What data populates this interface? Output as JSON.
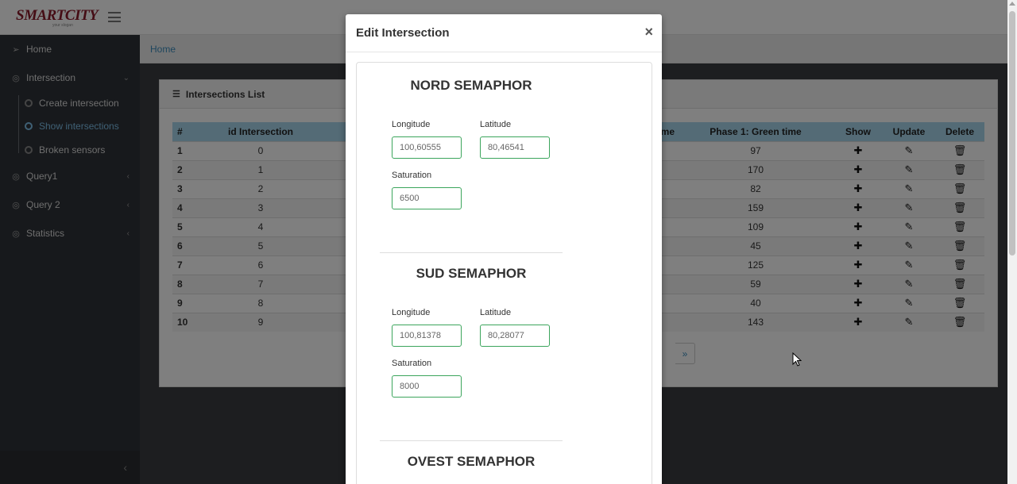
{
  "app": {
    "logo_main": "SMARTCITY",
    "logo_sub": "your slogan"
  },
  "sidebar": {
    "items": [
      {
        "label": "Home",
        "icon": "paper-plane-icon"
      },
      {
        "label": "Intersection",
        "icon": "circle-icon",
        "expanded": true
      },
      {
        "label": "Query1",
        "icon": "circle-icon"
      },
      {
        "label": "Query 2",
        "icon": "circle-icon"
      },
      {
        "label": "Statistics",
        "icon": "circle-icon"
      }
    ],
    "subitems": [
      {
        "label": "Create intersection"
      },
      {
        "label": "Show intersections",
        "active": true
      },
      {
        "label": "Broken sensors"
      }
    ]
  },
  "breadcrumb": {
    "home": "Home"
  },
  "panel": {
    "title": "Intersections List",
    "columns": {
      "num": "#",
      "id": "id Intersection",
      "time_frag": "time",
      "green": "Phase 1: Green time",
      "show": "Show",
      "update": "Update",
      "delete": "Delete"
    },
    "rows": [
      {
        "num": "1",
        "id": "0",
        "green": "97"
      },
      {
        "num": "2",
        "id": "1",
        "green": "170"
      },
      {
        "num": "3",
        "id": "2",
        "green": "82"
      },
      {
        "num": "4",
        "id": "3",
        "green": "159"
      },
      {
        "num": "5",
        "id": "4",
        "green": "109"
      },
      {
        "num": "6",
        "id": "5",
        "green": "45"
      },
      {
        "num": "7",
        "id": "6",
        "green": "125"
      },
      {
        "num": "8",
        "id": "7",
        "green": "59"
      },
      {
        "num": "9",
        "id": "8",
        "green": "40"
      },
      {
        "num": "10",
        "id": "9",
        "green": "143"
      }
    ],
    "pager_fragment": "»"
  },
  "modal": {
    "title": "Edit Intersection",
    "close": "×",
    "semaphores": [
      {
        "title": "NORD SEMAPHOR",
        "longitude_label": "Longitude",
        "latitude_label": "Latitude",
        "saturation_label": "Saturation",
        "longitude": "100,60555",
        "latitude": "80,46541",
        "saturation": "6500"
      },
      {
        "title": "SUD SEMAPHOR",
        "longitude_label": "Longitude",
        "latitude_label": "Latitude",
        "saturation_label": "Saturation",
        "longitude": "100,81378",
        "latitude": "80,28077",
        "saturation": "8000"
      },
      {
        "title": "OVEST SEMAPHOR"
      }
    ]
  },
  "colors": {
    "accent": "#3c8dbc",
    "table_header": "#a8d7ec",
    "input_border": "#3ba55c",
    "sidebar_bg": "#2f3338",
    "logo": "#8b1a2b"
  }
}
